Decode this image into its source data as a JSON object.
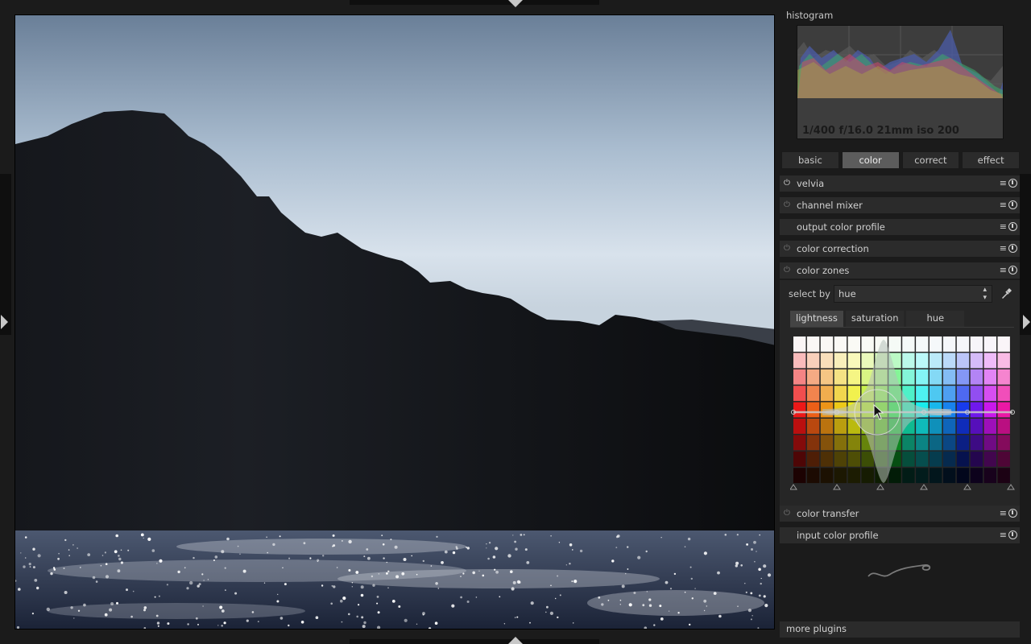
{
  "histogram": {
    "label": "histogram",
    "exif": "1/400 f/16.0 21mm iso 200"
  },
  "group_tabs": [
    {
      "label": "basic",
      "active": false
    },
    {
      "label": "color",
      "active": true
    },
    {
      "label": "correct",
      "active": false
    },
    {
      "label": "effect",
      "active": false
    }
  ],
  "modules_top": [
    {
      "name": "velvia",
      "enabled": true
    },
    {
      "name": "channel mixer",
      "enabled": false
    },
    {
      "name": "output color profile",
      "enabled": null
    },
    {
      "name": "color correction",
      "enabled": false
    },
    {
      "name": "color zones",
      "enabled": false,
      "expanded": true
    }
  ],
  "color_zones": {
    "select_by_label": "select by",
    "select_by_value": "hue",
    "tabs": [
      {
        "label": "lightness",
        "active": true
      },
      {
        "label": "saturation",
        "active": false
      },
      {
        "label": "hue",
        "active": false
      }
    ]
  },
  "modules_bottom": [
    {
      "name": "color transfer",
      "enabled": false
    },
    {
      "name": "input color profile",
      "enabled": null
    }
  ],
  "more_plugins": "more plugins",
  "icons": {
    "menu": "≡",
    "power": "⏻"
  },
  "colors": {
    "background": "#1b1b1b",
    "module_header": "#2b2b2b",
    "active_tab": "#5c5c5c"
  }
}
